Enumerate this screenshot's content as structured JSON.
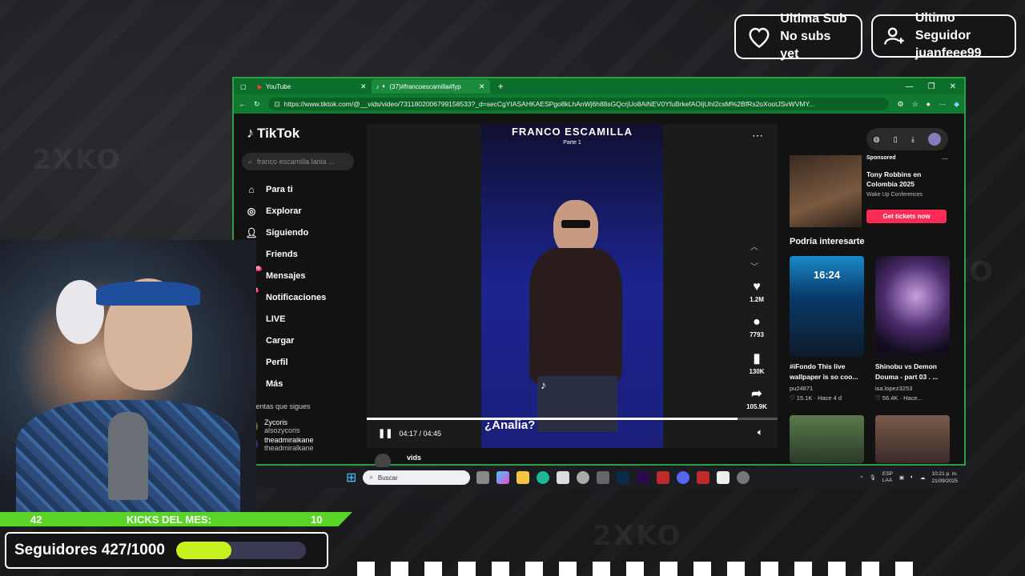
{
  "overlay": {
    "sub_card": {
      "title": "Ultima Sub",
      "value": "No subs yet"
    },
    "follower_card": {
      "title": "Ultimo Seguidor",
      "value": "juanfeee99"
    },
    "kicks": {
      "left_count": "42",
      "label": "KICKS DEL MES:",
      "right_count": "10"
    },
    "followers": {
      "label": "Seguidores 427/1000",
      "progress": 0.427
    }
  },
  "browser": {
    "tabs": [
      {
        "label": "YouTube",
        "icon": "youtube-icon"
      },
      {
        "label": "(37)#francoescamilla#fyp#p",
        "icon": "tiktok-icon"
      }
    ],
    "url": "https://www.tiktok.com/@__vids/video/7311802006799158533?_d=secCgYIASAHKAESPgo8kLhAnWj6h88sGQcrjUo8AiNEV0YfuBrkefAOIjUhI2csM%2BfRs2oXootJSvWVMY...",
    "accent": "#0b6e2a"
  },
  "tiktok": {
    "logo": "TikTok",
    "search_placeholder": "franco escamilla lania ...",
    "nav": [
      {
        "label": "Para ti",
        "icon": "home-icon"
      },
      {
        "label": "Explorar",
        "icon": "compass-icon"
      },
      {
        "label": "Siguiendo",
        "icon": "following-icon"
      },
      {
        "label": "Friends",
        "icon": "friends-icon"
      },
      {
        "label": "Mensajes",
        "icon": "messages-icon",
        "badge": "35"
      },
      {
        "label": "Notificaciones",
        "icon": "notifications-icon",
        "badge": "2"
      },
      {
        "label": "LIVE",
        "icon": "live-icon"
      },
      {
        "label": "Cargar",
        "icon": "upload-icon"
      },
      {
        "label": "Perfil",
        "icon": "profile-icon"
      },
      {
        "label": "Más",
        "icon": "more-icon"
      }
    ],
    "following_header": "Cuentas que sigues",
    "following": [
      {
        "name": "Zycoris",
        "handle": "alsozycoris"
      },
      {
        "name": "theadmiralkane",
        "handle": "theadmiralkane"
      }
    ],
    "video": {
      "title": "FRANCO ESCAMILLA",
      "subtitle": "Parte 1",
      "caption": "¿Analia?",
      "time": "04:17 / 04:45",
      "progress": 0.902,
      "author": "vids"
    },
    "actions": {
      "likes": "1.2M",
      "comments": "7793",
      "saves": "130K",
      "shares": "105.9K"
    },
    "ad": {
      "sponsored": "Sponsored",
      "title": "Tony Robbins en Colombia 2025",
      "by": "Wake Up Conferences",
      "button": "Get tickets now"
    },
    "interest_header": "Podría interesarte",
    "suggestions": [
      {
        "title": "#iFondo This live wallpaper is so coo...",
        "author": "pu24871",
        "meta": "♡ 15.1K · Hace 4 d",
        "thumb_time": "16:24"
      },
      {
        "title": "Shinobu vs Demon Douma - part 03 . ...",
        "author": "isa.lopez3253",
        "meta": "♡ 56.4K · Hace..."
      }
    ]
  },
  "taskbar": {
    "search_placeholder": "Buscar",
    "lang": "ESP\nLAA",
    "time": "10:21 p. m.",
    "date": "21/09/2025"
  }
}
